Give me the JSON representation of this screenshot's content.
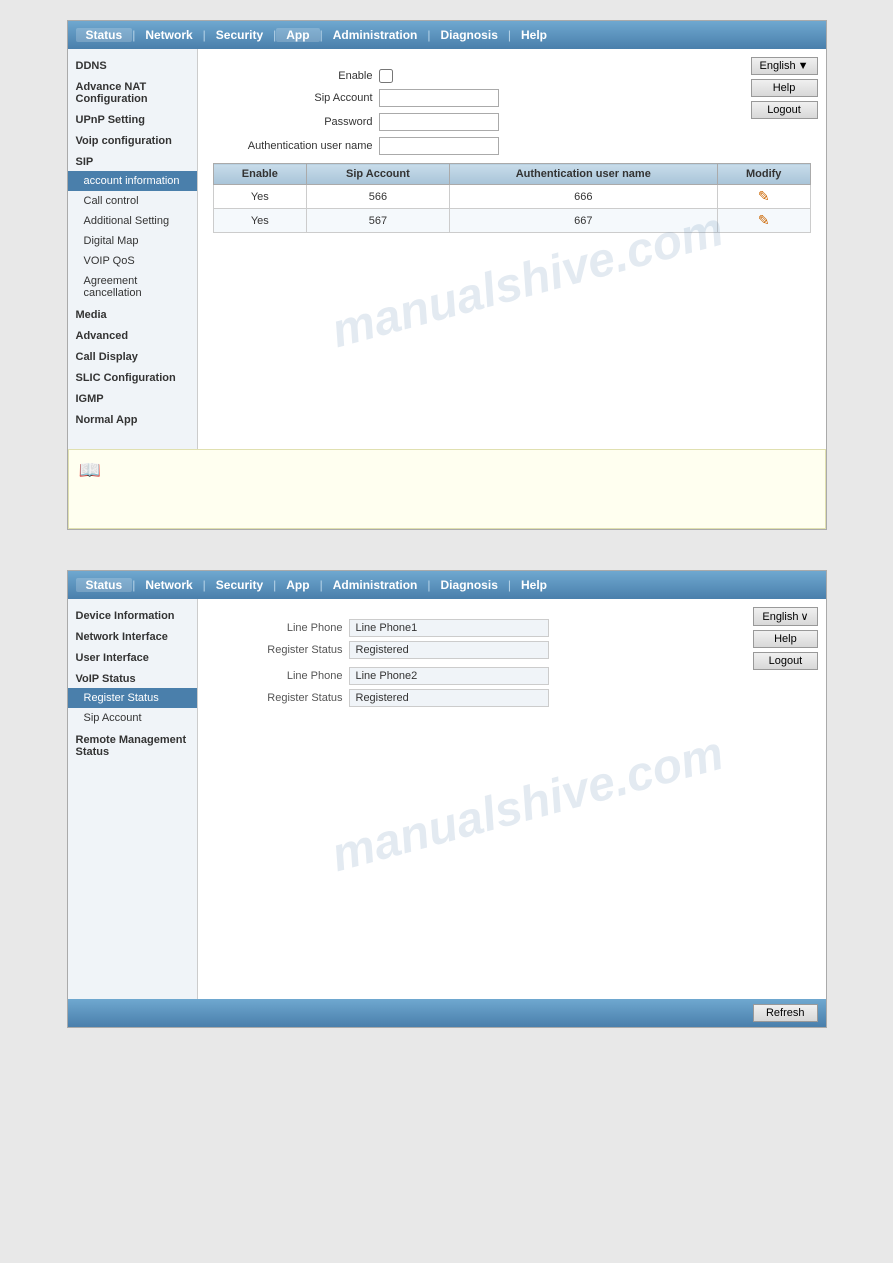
{
  "panel1": {
    "nav": {
      "items": [
        "Status",
        "Network",
        "Security",
        "App",
        "Administration",
        "Diagnosis",
        "Help"
      ],
      "active": "App"
    },
    "sidebar": {
      "sections": [
        {
          "label": "DDNS",
          "type": "section",
          "children": []
        },
        {
          "label": "Advance NAT Configuration",
          "type": "section",
          "children": []
        },
        {
          "label": "UPnP Setting",
          "type": "section",
          "children": []
        },
        {
          "label": "Voip configuration",
          "type": "section",
          "children": []
        },
        {
          "label": "SIP",
          "type": "section",
          "children": [
            {
              "label": "account information",
              "active": true
            },
            {
              "label": "Call control",
              "active": false
            },
            {
              "label": "Additional Setting",
              "active": false
            },
            {
              "label": "Digital Map",
              "active": false
            },
            {
              "label": "VOIP QoS",
              "active": false
            },
            {
              "label": "Agreement cancellation",
              "active": false
            }
          ]
        },
        {
          "label": "Media",
          "type": "section",
          "children": []
        },
        {
          "label": "Advanced",
          "type": "section",
          "children": []
        },
        {
          "label": "Call Display",
          "type": "section",
          "children": []
        },
        {
          "label": "SLIC Configuration",
          "type": "section",
          "children": []
        },
        {
          "label": "IGMP",
          "type": "section",
          "children": []
        },
        {
          "label": "Normal App",
          "type": "section",
          "children": []
        }
      ]
    },
    "form": {
      "enable_label": "Enable",
      "sip_account_label": "Sip Account",
      "password_label": "Password",
      "auth_user_label": "Authentication user name",
      "sip_account_value": "",
      "password_value": "",
      "auth_user_value": ""
    },
    "table": {
      "headers": [
        "Enable",
        "Sip Account",
        "Authentication user name",
        "Modify"
      ],
      "rows": [
        {
          "enable": "Yes",
          "sip_account": "566",
          "auth_user": "666",
          "modify": "✎"
        },
        {
          "enable": "Yes",
          "sip_account": "567",
          "auth_user": "667",
          "modify": "✎"
        }
      ]
    },
    "buttons": {
      "lang": "English",
      "lang_icon": "▼",
      "help": "Help",
      "logout": "Logout"
    },
    "info_box_icon": "📖"
  },
  "panel2": {
    "nav": {
      "items": [
        "Status",
        "Network",
        "Security",
        "App",
        "Administration",
        "Diagnosis",
        "Help"
      ],
      "active": "Status"
    },
    "sidebar": {
      "items": [
        {
          "label": "Device Information",
          "active": false
        },
        {
          "label": "Network Interface",
          "active": false
        },
        {
          "label": "User Interface",
          "active": false
        },
        {
          "label": "VoIP Status",
          "active": false,
          "children": [
            {
              "label": "Register Status",
              "active": true
            },
            {
              "label": "Sip Account",
              "active": false
            }
          ]
        },
        {
          "label": "Remote Management Status",
          "active": false
        }
      ]
    },
    "content": {
      "line_phone1_label": "Line Phone",
      "line_phone1_value": "Line Phone1",
      "register_status1_label": "Register Status",
      "register_status1_value": "Registered",
      "line_phone2_label": "Line Phone",
      "line_phone2_value": "Line Phone2",
      "register_status2_label": "Register Status",
      "register_status2_value": "Registered"
    },
    "buttons": {
      "lang": "English",
      "lang_icon": "∨",
      "help": "Help",
      "logout": "Logout",
      "refresh": "Refresh"
    }
  },
  "watermark": "manualshive.com"
}
